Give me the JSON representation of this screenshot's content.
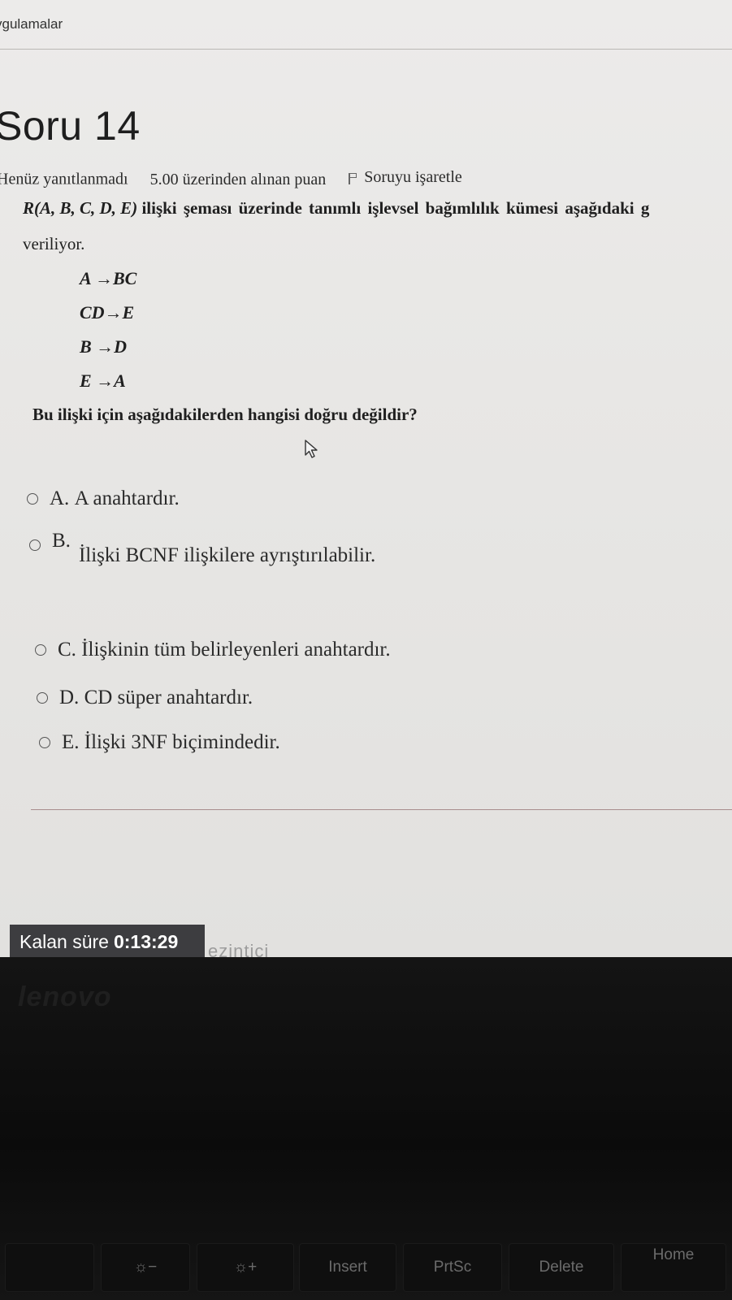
{
  "topbar": {
    "label": "ygulamalar"
  },
  "question": {
    "title": "Soru 14",
    "status": "Henüz yanıtlanmadı",
    "points": "5.00 üzerinden alınan puan",
    "flag_label": "Soruyu işaretle",
    "statement_line1_italic": "R(A, B, C, D, E)",
    "statement_line1_rest": "ilişki şeması üzerinde tanımlı işlevsel bağımlılık kümesi aşağıdaki g",
    "statement_line2": "veriliyor.",
    "dependencies": [
      "A →BC",
      "CD→E",
      "B →D",
      "E →A"
    ],
    "prompt": "Bu ilişki için aşağıdakilerden hangisi doğru değildir?"
  },
  "options": [
    {
      "letter": "A.",
      "text": "A anahtardır."
    },
    {
      "letter": "B.",
      "text": "İlişki BCNF ilişkilere ayrıştırılabilir."
    },
    {
      "letter": "C.",
      "text": "İlişkinin tüm belirleyenleri anahtardır."
    },
    {
      "letter": "D.",
      "text": "CD süper anahtardır."
    },
    {
      "letter": "E.",
      "text": "İlişki 3NF biçimindedir."
    }
  ],
  "timer": {
    "label": "Kalan süre",
    "time": "0:13:29"
  },
  "partial_link": "ezintici",
  "device": {
    "brand": "lenovo",
    "keys": [
      "",
      "☼−",
      "☼+",
      "Insert",
      "PrtSc",
      "Delete",
      "Home"
    ]
  }
}
